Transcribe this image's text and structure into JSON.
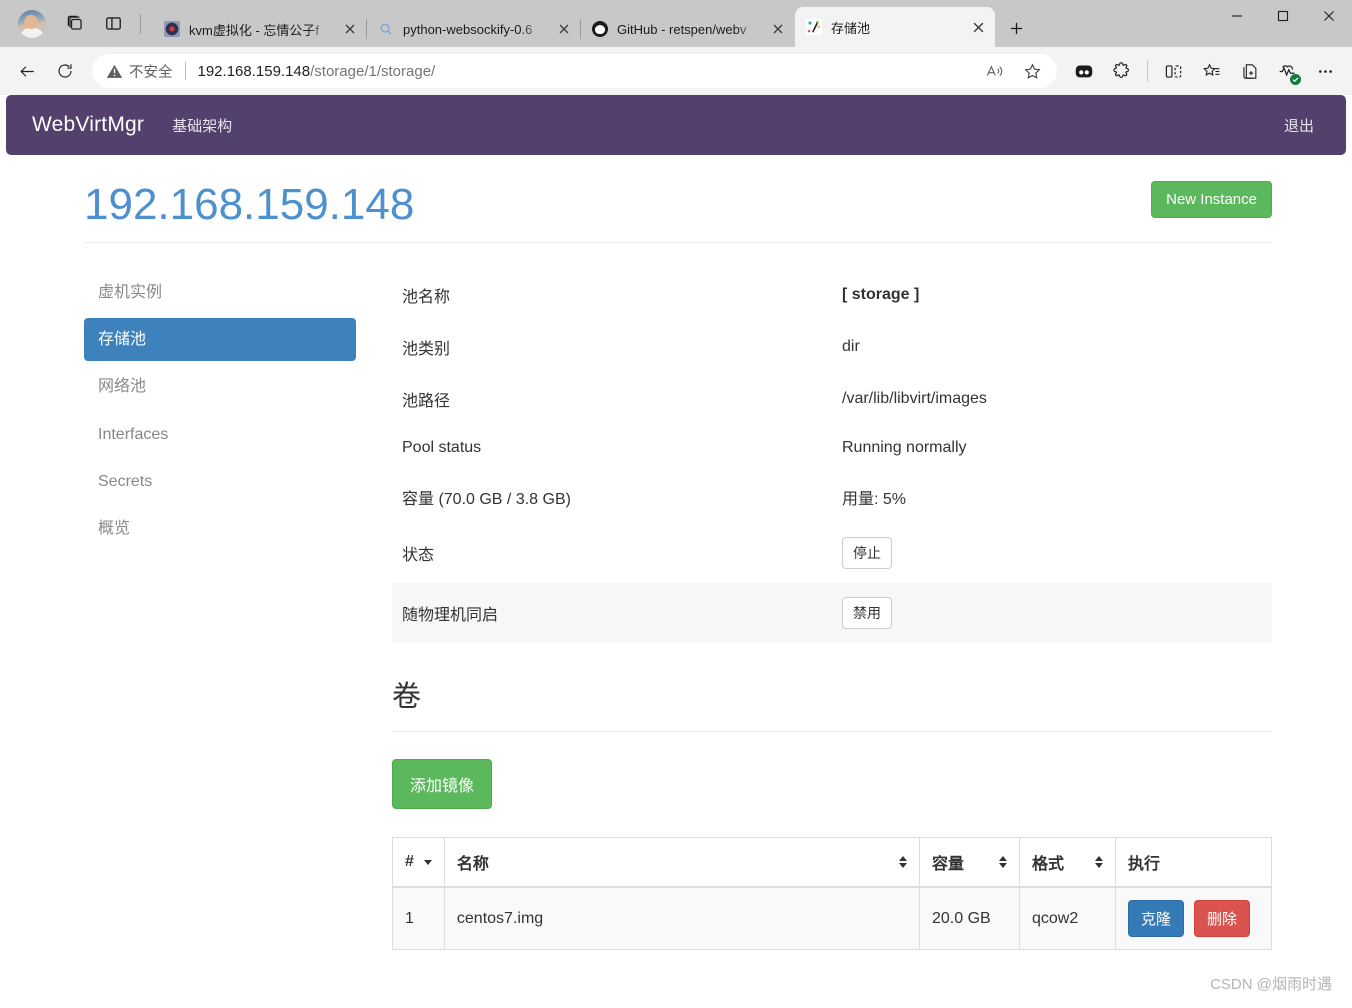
{
  "browser": {
    "profile_icon": "avatar",
    "workspaces_icon": "workspaces-icon",
    "tab_actions_icon": "tab-actions-icon",
    "tabs": [
      {
        "title": "kvm虚拟化 - 忘情公子f",
        "favicon": "kvm-favicon",
        "active": false
      },
      {
        "title": "python-websockify-0.6",
        "favicon": "search-favicon",
        "active": false
      },
      {
        "title": "GitHub - retspen/webv",
        "favicon": "github-favicon",
        "active": false
      },
      {
        "title": "存储池",
        "favicon": "webvirtmgr-favicon",
        "active": true
      }
    ],
    "new_tab_label": "+",
    "window_controls": {
      "minimize": "—",
      "maximize": "▢",
      "close": "✕"
    },
    "toolbar": {
      "back_icon": "back-arrow-icon",
      "refresh_icon": "refresh-icon",
      "security_label": "不安全",
      "url_host": "192.168.159.148",
      "url_path": "/storage/1/storage/",
      "read_aloud_icon": "read-aloud-icon",
      "favorite_icon": "star-icon",
      "split_screen_icon": "split-screen-icon",
      "collections_icon": "collections-icon",
      "add_tab_icon": "add-to-collection-icon",
      "browser_essentials_icon": "browser-essentials-icon",
      "settings_icon": "more-options-icon",
      "copilot_icon": "copilot-icon",
      "extensions_icon": "extensions-icon"
    }
  },
  "app": {
    "navbar": {
      "brand": "WebVirtMgr",
      "links": [
        {
          "label": "基础架构"
        }
      ],
      "logout": "退出"
    },
    "page_title": "192.168.159.148",
    "new_instance_button": "New Instance",
    "sidebar": {
      "items": [
        {
          "label": "虚机实例",
          "active": false
        },
        {
          "label": "存储池",
          "active": true
        },
        {
          "label": "网络池",
          "active": false
        },
        {
          "label": "Interfaces",
          "active": false
        },
        {
          "label": "Secrets",
          "active": false
        },
        {
          "label": "概览",
          "active": false
        }
      ]
    },
    "pool_info": [
      {
        "key": "池名称",
        "value": "[ storage ]",
        "bold": true,
        "striped": false,
        "type": "text"
      },
      {
        "key": "池类别",
        "value": "dir",
        "bold": false,
        "striped": false,
        "type": "text"
      },
      {
        "key": "池路径",
        "value": "/var/lib/libvirt/images",
        "bold": false,
        "striped": false,
        "type": "text"
      },
      {
        "key": "Pool status",
        "value": "Running normally",
        "bold": false,
        "striped": false,
        "type": "text"
      },
      {
        "key": "容量 (70.0 GB / 3.8 GB)",
        "value": "用量: 5%",
        "bold": false,
        "striped": false,
        "type": "text"
      },
      {
        "key": "状态",
        "value": "停止",
        "bold": false,
        "striped": false,
        "type": "badge"
      },
      {
        "key": "随物理机同启",
        "value": "禁用",
        "bold": false,
        "striped": true,
        "type": "badge"
      }
    ],
    "volumes": {
      "section_title": "卷",
      "add_image_button": "添加镜像",
      "columns": [
        {
          "label": "#",
          "sort": "down"
        },
        {
          "label": "名称",
          "sort": "updown"
        },
        {
          "label": "容量",
          "sort": "updown"
        },
        {
          "label": "格式",
          "sort": "updown"
        },
        {
          "label": "执行",
          "sort": "none"
        }
      ],
      "rows": [
        {
          "num": "1",
          "name": "centos7.img",
          "capacity": "20.0 GB",
          "format": "qcow2",
          "clone_button": "克隆",
          "delete_button": "删除"
        }
      ]
    },
    "colors": {
      "navbar": "#53406d",
      "title": "#4d90ce",
      "green": "#5cb85c",
      "blue": "#337ab7",
      "red": "#d9534f",
      "sidebar_active": "#3d82bd"
    }
  },
  "watermark": "CSDN @烟雨时遇"
}
